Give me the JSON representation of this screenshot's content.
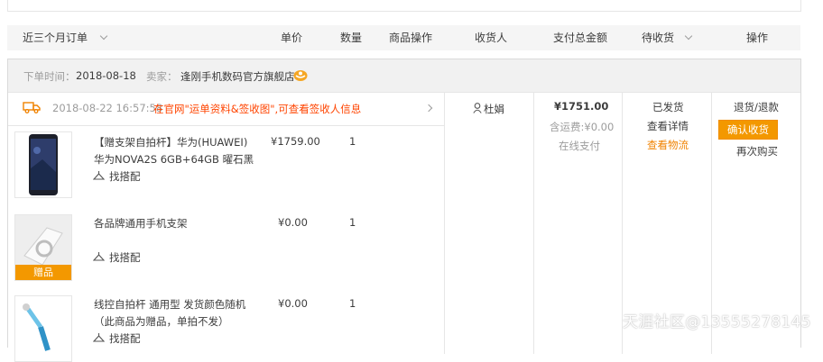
{
  "header": {
    "period_filter": "近三个月订单",
    "unit_price": "单价",
    "quantity": "数量",
    "item_ops": "商品操作",
    "receiver": "收货人",
    "total": "支付总金额",
    "status_filter": "待收货",
    "actions": "操作"
  },
  "order": {
    "order_time_label": "下单时间：",
    "order_time": "2018-08-18",
    "seller_label": "卖家：",
    "seller": "逢刚手机数码官方旗舰店",
    "logistics_time": "2018-08-22 16:57:58",
    "logistics_msg": "在官网\"运单资料&签收图\",可查看签收人信息",
    "receiver": "杜娟",
    "total": "¥1751.00",
    "shipping": "含运费:¥0.00",
    "payment": "在线支付",
    "status": "已发货",
    "detail_link": "查看详情",
    "logistics_link": "查看物流",
    "refund": "退货/退款",
    "confirm": "确认收货",
    "rebuy": "再次购买"
  },
  "items": [
    {
      "title_line1": "【赠支架自拍杆】华为(HUAWEI)",
      "title_line2": "华为NOVA2S 6GB+64GB 曜石黑",
      "price": "¥1759.00",
      "qty": "1",
      "match": "找搭配"
    },
    {
      "title_line1": "各品牌通用手机支架",
      "price": "¥0.00",
      "qty": "1",
      "match": "找搭配",
      "gift_tag": "赠品"
    },
    {
      "title_line1": "线控自拍杆 通用型 发货颜色随机",
      "title_line2": "（此商品为赠品，单拍不发）",
      "price": "¥0.00",
      "qty": "1",
      "match": "找搭配"
    }
  ],
  "watermark": "天涯社区@13555278145",
  "colors": {
    "accent": "#f39800",
    "link_orange": "#ff4400",
    "header_bg": "#f5f5f5"
  }
}
